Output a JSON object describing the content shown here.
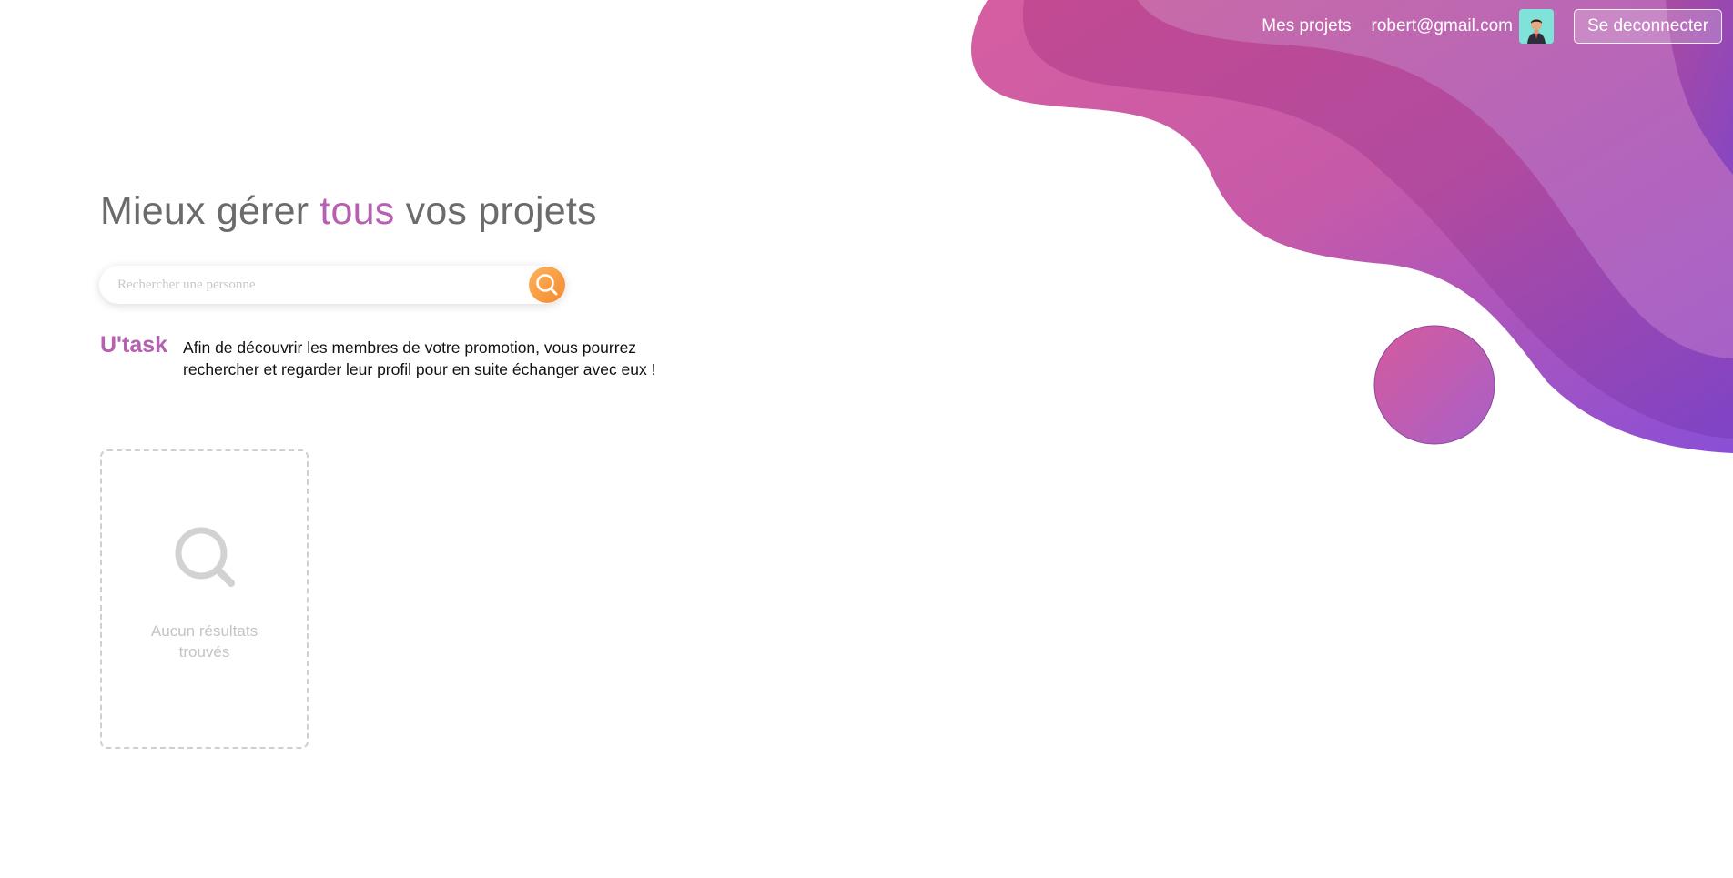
{
  "nav": {
    "projects_label": "Mes projets",
    "user_email": "robert@gmail.com",
    "logout_label": "Se deconnecter"
  },
  "hero": {
    "title_before": "Mieux gérer ",
    "title_accent": "tous",
    "title_after": " vos projets"
  },
  "search": {
    "placeholder": "Rechercher une personne",
    "value": ""
  },
  "intro": {
    "brand": "U'task",
    "text": "Afin de découvrir les membres de votre promotion, vous pourrez rechercher et regarder leur profil pour en suite échanger avec eux !"
  },
  "results": {
    "empty_message": "Aucun résultats trouvés"
  },
  "colors": {
    "accent": "#b560b0",
    "search_button": "#f59a3e",
    "wave_pink": "#d45a9c",
    "wave_purple": "#8b4fd0"
  },
  "icons": {
    "search_button": "search-icon",
    "empty_results": "search-icon",
    "avatar": "user-avatar"
  }
}
